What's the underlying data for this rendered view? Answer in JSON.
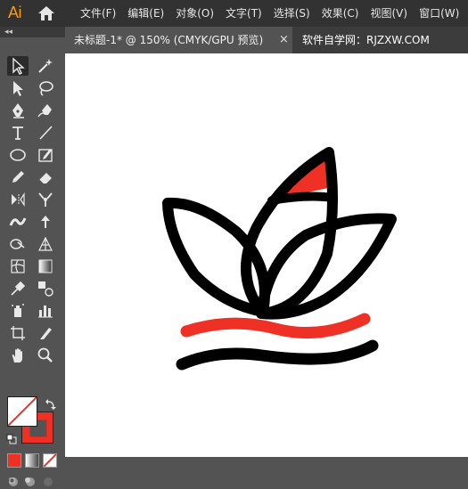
{
  "app": {
    "logo": "Ai"
  },
  "menu": [
    "文件(F)",
    "编辑(E)",
    "对象(O)",
    "文字(T)",
    "选择(S)",
    "效果(C)",
    "视图(V)",
    "窗口(W)"
  ],
  "tab": {
    "label": "未标题-1* @ 150% (CMYK/GPU 预览)",
    "close": "×"
  },
  "watermark": "软件自学网：RJZXW.COM",
  "panel": {
    "collapse": "◂◂"
  },
  "colors": {
    "fill": "#ffffff",
    "stroke": "#ee3124",
    "accent_red": "#ee3124",
    "line": "#000000"
  },
  "tools": [
    "selection-tool",
    "magic-wand-tool",
    "direct-selection-tool",
    "lasso-tool",
    "pen-tool",
    "curvature-tool",
    "type-tool",
    "line-segment-tool",
    "ellipse-tool",
    "paintbrush-tool",
    "pencil-tool",
    "eraser-tool",
    "rotate-tool",
    "scale-tool",
    "width-tool",
    "free-transform-tool",
    "shape-builder-tool",
    "perspective-grid-tool",
    "mesh-tool",
    "gradient-tool",
    "eyedropper-tool",
    "blend-tool",
    "symbol-sprayer-tool",
    "column-graph-tool",
    "artboard-tool",
    "slice-tool",
    "hand-tool",
    "zoom-tool"
  ]
}
